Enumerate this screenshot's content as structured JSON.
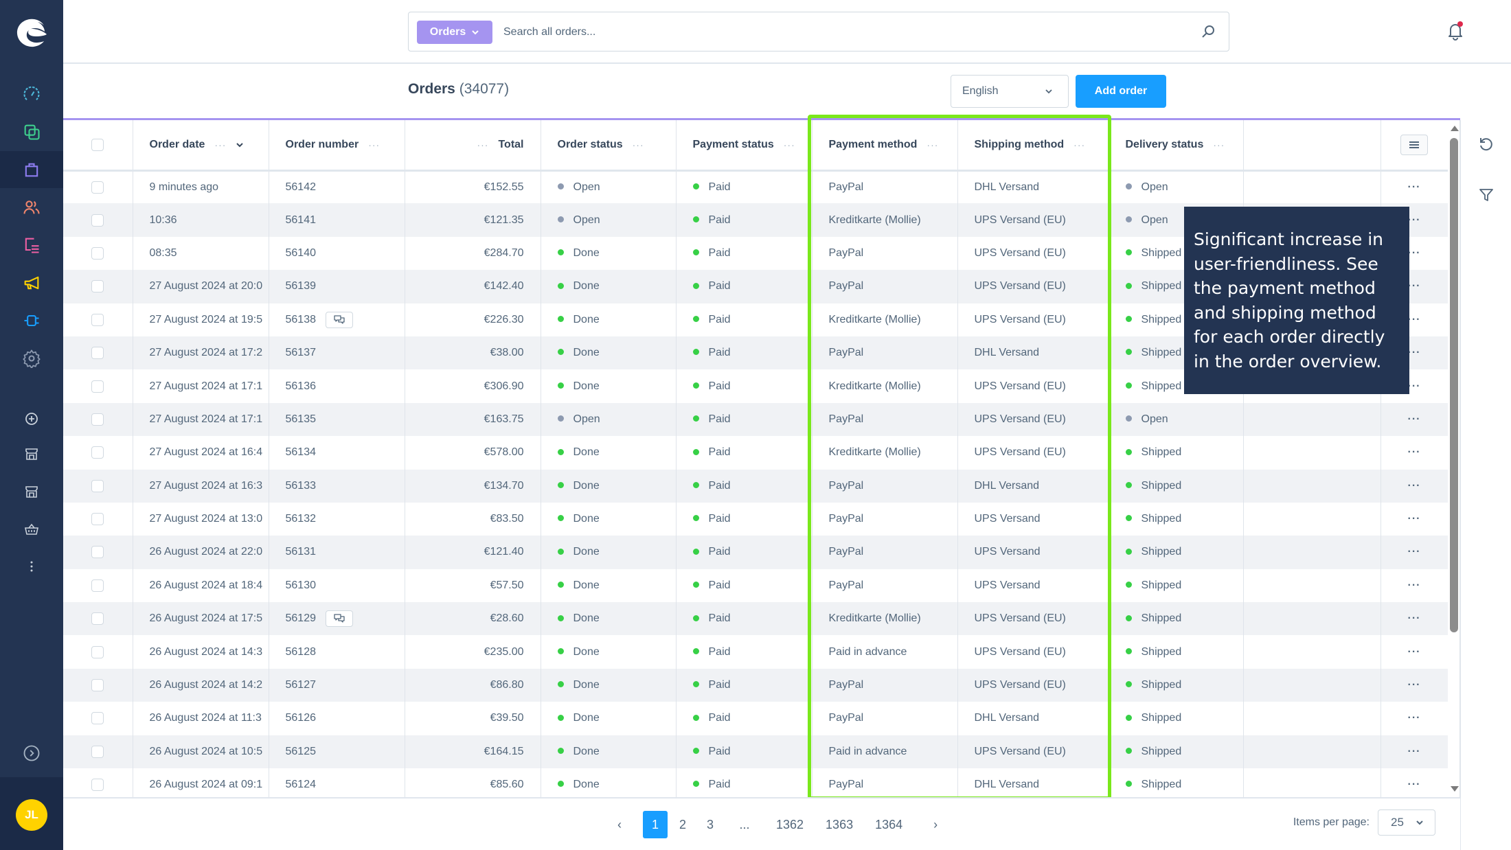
{
  "sidebar": {
    "items": [
      {
        "name": "dashboard",
        "icon": "gauge-icon",
        "color": "#4db8d9"
      },
      {
        "name": "catalogues",
        "icon": "layers-icon",
        "color": "#3ecf8e"
      },
      {
        "name": "orders",
        "icon": "shopping-bag-icon",
        "color": "#8d7cf0",
        "active": true
      },
      {
        "name": "customers",
        "icon": "users-icon",
        "color": "#f0856c"
      },
      {
        "name": "content",
        "icon": "content-list-icon",
        "color": "#ee5fa3"
      },
      {
        "name": "marketing",
        "icon": "megaphone-icon",
        "color": "#ffd200"
      },
      {
        "name": "extensions",
        "icon": "plug-icon",
        "color": "#189eff"
      },
      {
        "name": "settings",
        "icon": "gear-icon",
        "color": "#8d9ab0"
      }
    ],
    "sales_channels": [
      {
        "name": "add-sales-channel",
        "icon": "plus-circle-icon"
      },
      {
        "name": "storefront-1",
        "icon": "storefront-icon"
      },
      {
        "name": "storefront-2",
        "icon": "storefront-icon"
      },
      {
        "name": "headless",
        "icon": "basket-icon"
      },
      {
        "name": "more",
        "icon": "more-vertical-icon"
      }
    ],
    "avatar_initials": "JL"
  },
  "search": {
    "type_label": "Orders",
    "placeholder": "Search all orders..."
  },
  "header": {
    "title": "Orders",
    "count": "(34077)",
    "language": "English",
    "add_button": "Add order"
  },
  "table": {
    "columns": [
      {
        "label": "Order date",
        "sortable": true
      },
      {
        "label": "Order number"
      },
      {
        "label": "Total"
      },
      {
        "label": "Order status"
      },
      {
        "label": "Payment status"
      },
      {
        "label": "Payment method"
      },
      {
        "label": "Shipping method"
      },
      {
        "label": "Delivery status"
      }
    ],
    "rows": [
      {
        "date": "9 minutes ago",
        "number": "56142",
        "comment": false,
        "total": "€152.55",
        "order_status": "Open",
        "payment_status": "Paid",
        "payment_method": "PayPal",
        "shipping_method": "DHL Versand",
        "delivery_status": "Open"
      },
      {
        "date": "10:36",
        "number": "56141",
        "comment": false,
        "total": "€121.35",
        "order_status": "Open",
        "payment_status": "Paid",
        "payment_method": "Kreditkarte (Mollie)",
        "shipping_method": "UPS Versand (EU)",
        "delivery_status": "Open"
      },
      {
        "date": "08:35",
        "number": "56140",
        "comment": false,
        "total": "€284.70",
        "order_status": "Done",
        "payment_status": "Paid",
        "payment_method": "PayPal",
        "shipping_method": "UPS Versand (EU)",
        "delivery_status": "Shipped"
      },
      {
        "date": "27 August 2024 at 20:0",
        "number": "56139",
        "comment": false,
        "total": "€142.40",
        "order_status": "Done",
        "payment_status": "Paid",
        "payment_method": "PayPal",
        "shipping_method": "UPS Versand (EU)",
        "delivery_status": "Shipped"
      },
      {
        "date": "27 August 2024 at 19:5",
        "number": "56138",
        "comment": true,
        "total": "€226.30",
        "order_status": "Done",
        "payment_status": "Paid",
        "payment_method": "Kreditkarte (Mollie)",
        "shipping_method": "UPS Versand (EU)",
        "delivery_status": "Shipped"
      },
      {
        "date": "27 August 2024 at 17:2",
        "number": "56137",
        "comment": false,
        "total": "€38.00",
        "order_status": "Done",
        "payment_status": "Paid",
        "payment_method": "PayPal",
        "shipping_method": "DHL Versand",
        "delivery_status": "Shipped"
      },
      {
        "date": "27 August 2024 at 17:1",
        "number": "56136",
        "comment": false,
        "total": "€306.90",
        "order_status": "Done",
        "payment_status": "Paid",
        "payment_method": "Kreditkarte (Mollie)",
        "shipping_method": "UPS Versand (EU)",
        "delivery_status": "Shipped"
      },
      {
        "date": "27 August 2024 at 17:1",
        "number": "56135",
        "comment": false,
        "total": "€163.75",
        "order_status": "Open",
        "payment_status": "Paid",
        "payment_method": "PayPal",
        "shipping_method": "UPS Versand (EU)",
        "delivery_status": "Open"
      },
      {
        "date": "27 August 2024 at 16:4",
        "number": "56134",
        "comment": false,
        "total": "€578.00",
        "order_status": "Done",
        "payment_status": "Paid",
        "payment_method": "Kreditkarte (Mollie)",
        "shipping_method": "UPS Versand (EU)",
        "delivery_status": "Shipped"
      },
      {
        "date": "27 August 2024 at 16:3",
        "number": "56133",
        "comment": false,
        "total": "€134.70",
        "order_status": "Done",
        "payment_status": "Paid",
        "payment_method": "PayPal",
        "shipping_method": "DHL Versand",
        "delivery_status": "Shipped"
      },
      {
        "date": "27 August 2024 at 13:0",
        "number": "56132",
        "comment": false,
        "total": "€83.50",
        "order_status": "Done",
        "payment_status": "Paid",
        "payment_method": "PayPal",
        "shipping_method": "UPS Versand",
        "delivery_status": "Shipped"
      },
      {
        "date": "26 August 2024 at 22:0",
        "number": "56131",
        "comment": false,
        "total": "€121.40",
        "order_status": "Done",
        "payment_status": "Paid",
        "payment_method": "PayPal",
        "shipping_method": "UPS Versand",
        "delivery_status": "Shipped"
      },
      {
        "date": "26 August 2024 at 18:4",
        "number": "56130",
        "comment": false,
        "total": "€57.50",
        "order_status": "Done",
        "payment_status": "Paid",
        "payment_method": "PayPal",
        "shipping_method": "UPS Versand",
        "delivery_status": "Shipped"
      },
      {
        "date": "26 August 2024 at 17:5",
        "number": "56129",
        "comment": true,
        "total": "€28.60",
        "order_status": "Done",
        "payment_status": "Paid",
        "payment_method": "Kreditkarte (Mollie)",
        "shipping_method": "UPS Versand (EU)",
        "delivery_status": "Shipped"
      },
      {
        "date": "26 August 2024 at 14:3",
        "number": "56128",
        "comment": false,
        "total": "€235.00",
        "order_status": "Done",
        "payment_status": "Paid",
        "payment_method": "Paid in advance",
        "shipping_method": "UPS Versand (EU)",
        "delivery_status": "Shipped"
      },
      {
        "date": "26 August 2024 at 14:2",
        "number": "56127",
        "comment": false,
        "total": "€86.80",
        "order_status": "Done",
        "payment_status": "Paid",
        "payment_method": "PayPal",
        "shipping_method": "UPS Versand (EU)",
        "delivery_status": "Shipped"
      },
      {
        "date": "26 August 2024 at 11:3",
        "number": "56126",
        "comment": false,
        "total": "€39.50",
        "order_status": "Done",
        "payment_status": "Paid",
        "payment_method": "PayPal",
        "shipping_method": "DHL Versand",
        "delivery_status": "Shipped"
      },
      {
        "date": "26 August 2024 at 10:5",
        "number": "56125",
        "comment": false,
        "total": "€164.15",
        "order_status": "Done",
        "payment_status": "Paid",
        "payment_method": "Paid in advance",
        "shipping_method": "UPS Versand (EU)",
        "delivery_status": "Shipped"
      },
      {
        "date": "26 August 2024 at 09:1",
        "number": "56124",
        "comment": false,
        "total": "€85.60",
        "order_status": "Done",
        "payment_status": "Paid",
        "payment_method": "PayPal",
        "shipping_method": "DHL Versand",
        "delivery_status": "Shipped"
      }
    ],
    "status_colors": {
      "Open": "#8d9ab0",
      "Done": "#37d046",
      "Paid": "#37d046",
      "Shipped": "#37d046"
    }
  },
  "pagination": {
    "prev": "‹",
    "next": "›",
    "pages": [
      "1",
      "2",
      "3",
      "...",
      "1362",
      "1363",
      "1364"
    ],
    "current": "1",
    "items_per_page_label": "Items per page:",
    "items_per_page": "25"
  },
  "annotation": {
    "text": "Significant increase in user-friendliness. See the payment method and shipping method for each order directly in the order overview.",
    "highlight_color": "#7ae81b"
  },
  "colors": {
    "sidebar_bg": "#233452",
    "accent": "#189eff",
    "search_type": "#a594f0"
  }
}
